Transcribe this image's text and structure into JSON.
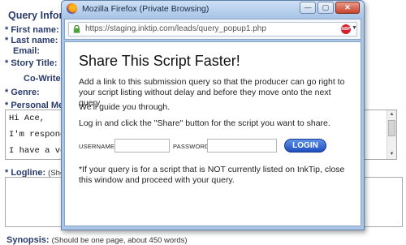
{
  "background_form": {
    "heading": "Query Informat",
    "labels": {
      "first_name": "* First name:",
      "last_name": "* Last name:",
      "email": "Email:",
      "story_title": "* Story Title:",
      "co_writers": "Co-Writer(s):",
      "genre": "* Genre:",
      "personal_message": "* Personal Messa",
      "logline": "* Logline:",
      "logline_hint": "(Should",
      "synopsis": "Synopsis:",
      "synopsis_hint": "(Should be one page, about 450 words)"
    },
    "message_lines": [
      "Hi Ace,",
      "I'm respondin",
      "I have a very"
    ]
  },
  "popup": {
    "window_title": "Mozilla Firefox (Private Browsing)",
    "window_buttons": {
      "minimize": "—",
      "maximize": "▢",
      "close": "✕"
    },
    "url": "https://staging.inktip.com/leads/query_popup1.php",
    "addon_badge": "ABP",
    "heading": "Share This Script Faster!",
    "paragraphs": [
      "Add a link to this submission query so that the producer can go right to your script listing without delay and before they move onto the next query.",
      "We'll guide you through.",
      "Log in and click the \"Share\" button for the script you want to share."
    ],
    "login": {
      "username_label": "USERNAME",
      "username_value": "",
      "password_label": "PASSWORD",
      "password_value": "",
      "button_label": "LOGIN"
    },
    "footnote": "*If your query is for a script that is NOT currently listed on InkTip, close this window and proceed with your query."
  },
  "colors": {
    "label_blue": "#2a3c6e",
    "popup_frame": "#a9c6e8",
    "login_button": "#1f4fbf"
  },
  "icons": [
    "firefox-icon",
    "lock-icon",
    "adblock-icon",
    "scroll-up-icon",
    "scroll-down-icon"
  ]
}
